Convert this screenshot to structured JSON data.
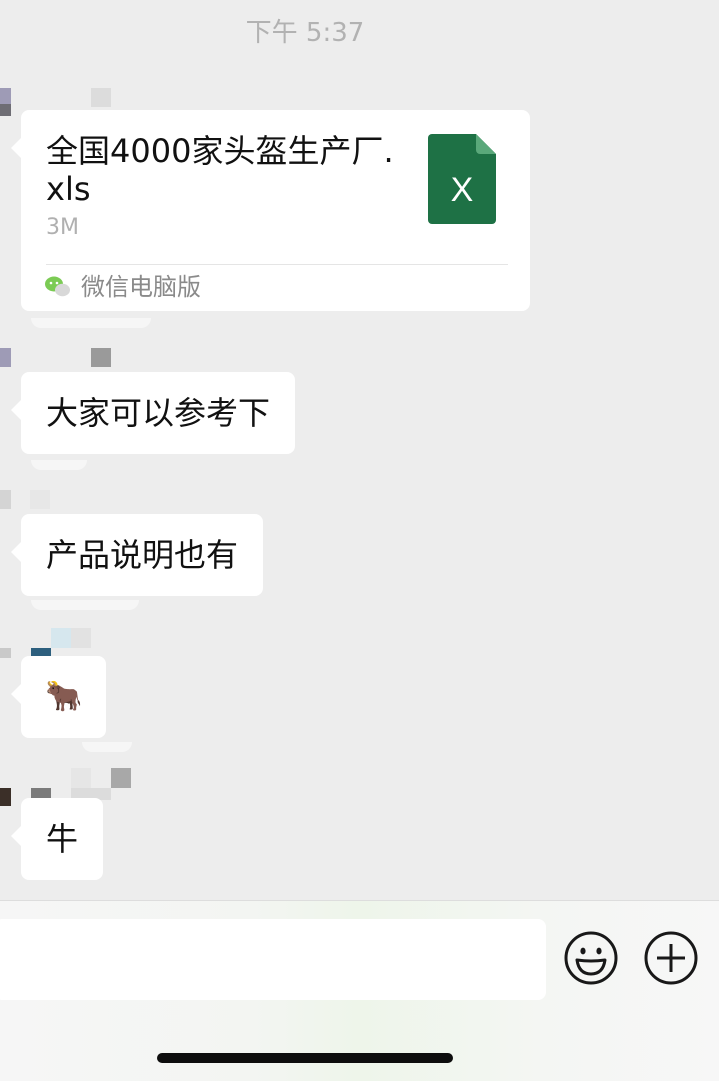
{
  "chat": {
    "timestamp": "下午 5:37",
    "file_message": {
      "file_name": "全国4000家头盔生产厂.xls",
      "file_size": "3M",
      "file_icon": "excel-file-icon",
      "file_icon_letter": "X",
      "source": "微信电脑版",
      "source_icon": "wechat-icon"
    },
    "messages": [
      {
        "text": "大家可以参考下"
      },
      {
        "text": "产品说明也有"
      },
      {
        "text": "🐂"
      },
      {
        "text": "牛"
      }
    ]
  },
  "input_bar": {
    "emoji_icon": "emoji-icon",
    "plus_icon": "plus-icon"
  },
  "colors": {
    "background": "#ededed",
    "bubble": "#ffffff",
    "excel_green": "#1e7145",
    "timestamp": "#b2b2b2"
  }
}
